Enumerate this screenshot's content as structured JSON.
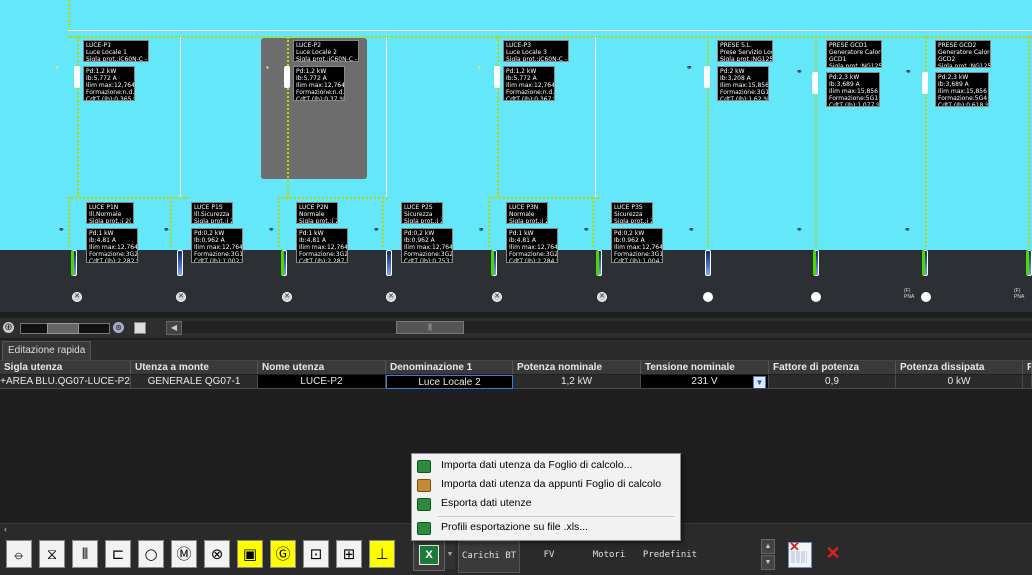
{
  "schematic": {
    "top_labels": [
      {
        "id": "p1",
        "lines": [
          "LUCE-P1",
          "Luce Locale 1",
          "Sigla prot.:iC60N-C - 1("
        ]
      },
      {
        "id": "p2",
        "lines": [
          "LUCE-P2",
          "Luce Locale 2",
          "Sigla prot.:iC60N-C - 1("
        ]
      },
      {
        "id": "p3",
        "lines": [
          "LUCE-P3",
          "Luce Locale 3",
          "Sigla prot.:iC60N-C - 1("
        ]
      },
      {
        "id": "ps",
        "lines": [
          "PRESE S.L.",
          "Prese Servizio Locali",
          "Sigla prot.:NG125L-"
        ]
      },
      {
        "id": "gcd1",
        "lines": [
          "PRESE GCD1",
          "Generatore Calore",
          "GCD1",
          "Sigla prot.:NG125L-"
        ]
      },
      {
        "id": "gcd2",
        "lines": [
          "PRESE GCD2",
          "Generatore Calore",
          "GCD2",
          "Sigla prot.:NG125N-"
        ]
      }
    ],
    "top_data": [
      {
        "id": "p1",
        "lines": [
          "Pd:1,2 kW",
          "Ib:5,772 A",
          "Ilim max:12,764 kA",
          "Formazione:n.d.",
          "CdtT (Ib):0,365 %"
        ]
      },
      {
        "id": "p2",
        "lines": [
          "Pd:1,2 kW",
          "Ib:5,772 A",
          "Ilim max:12,764 kA",
          "Formazione:n.d.",
          "CdtT (Ib):0,37 %"
        ]
      },
      {
        "id": "p3",
        "lines": [
          "Pd:1,2 kW",
          "Ib:5,772 A",
          "Ilim max:12,764 kA",
          "Formazione:n.d.",
          "CdtT (Ib):0,367 %"
        ]
      },
      {
        "id": "ps",
        "lines": [
          "Pd:2 kW",
          "Ib:3,208 A",
          "Ilim max:15,856 kA",
          "Formazione:3G1.5",
          "CdtT (Ib):1,62 %"
        ]
      },
      {
        "id": "gcd1",
        "lines": [
          "Pd:2,3 kW",
          "Ib:3,689 A",
          "Ilim max:15,856 kA",
          "Formazione:5G1.5",
          "CdtT (Ib):1,077 %"
        ]
      },
      {
        "id": "gcd2",
        "lines": [
          "Pd:2,3 kW",
          "Ib:3,689 A",
          "Ilim max:15,856 kA",
          "Formazione:5G4",
          "CdtT (Ib):0,618 %"
        ]
      }
    ],
    "bottom_labels": [
      {
        "id": "p1n",
        "lines": [
          "LUCE P1N",
          "Ill.Normale",
          "Sigla prot.:i 2("
        ]
      },
      {
        "id": "p1s",
        "lines": [
          "LUCE P1S",
          "Ill.Sicurezza",
          "Sigla prot.:i 2("
        ]
      },
      {
        "id": "p2n",
        "lines": [
          "LUCE P2N",
          "Normale",
          "Sigla prot.:i 2("
        ]
      },
      {
        "id": "p2s",
        "lines": [
          "LUCE P2S",
          "Sicurezza",
          "Sigla prot.:i 2("
        ]
      },
      {
        "id": "p3n",
        "lines": [
          "LUCE P3N",
          "Normale",
          "Sigla prot.:i 2("
        ]
      },
      {
        "id": "p3s",
        "lines": [
          "LUCE P3S",
          "Sicurezza",
          "Sigla prot.:i 2("
        ]
      }
    ],
    "bottom_data": [
      {
        "id": "p1n",
        "lines": [
          "Pd:1 kW",
          "Ib:4,81 A",
          "Ilim max:12,764 kA",
          "Formazione:3G2.5",
          "CdtT (Ib):2,282 %"
        ]
      },
      {
        "id": "p1s",
        "lines": [
          "Pd:0,2 kW",
          "Ib:0,962 A",
          "Ilim max:12,764 kA",
          "Formazione:3G1.5",
          "CdtT (Ib):1,002 %"
        ]
      },
      {
        "id": "p2n",
        "lines": [
          "Pd:1 kW",
          "Ib:4,81 A",
          "Ilim max:12,764 kA",
          "Formazione:3G2.5",
          "CdtT (Ib):2,287 %"
        ]
      },
      {
        "id": "p2s",
        "lines": [
          "Pd:0,2 kW",
          "Ib:0,962 A",
          "Ilim max:12,764 kA",
          "Formazione:3G2.5",
          "CdtT (Ib):0,753 %"
        ]
      },
      {
        "id": "p3n",
        "lines": [
          "Pd:1 kW",
          "Ib:4,81 A",
          "Ilim max:12,764 kA",
          "Formazione:3G2.5",
          "CdtT (Ib):2,284 %"
        ]
      },
      {
        "id": "p3s",
        "lines": [
          "Pd:0,2 kW",
          "Ib:0,962 A",
          "Ilim max:12,764 kA",
          "Formazione:3G1.5",
          "CdtT (Ib):1,004 %"
        ]
      }
    ],
    "pna_label": "(F)\nPNA"
  },
  "toolbar": {
    "scroll_thumb_glyph": "||"
  },
  "tabs": {
    "active_label": "Editazione rapida"
  },
  "grid": {
    "headers": [
      "Sigla utenza",
      "Utenza a monte",
      "Nome utenza",
      "Denominazione 1",
      "Potenza nominale",
      "Tensione nominale",
      "Fattore di potenza",
      "Potenza dissipata",
      "P"
    ],
    "row": {
      "sigla": "+AREA BLU.QG07-LUCE-P2",
      "utenza_monte": "GENERALE QG07-1",
      "nome": "LUCE-P2",
      "denominazione": "Luce Locale 2",
      "potenza": "1,2 kW",
      "tensione": "231 V",
      "fattore": "0,9",
      "dissipata": "0 kW"
    }
  },
  "menu": {
    "items": [
      {
        "label": "Importa dati utenza da Foglio di calcolo..."
      },
      {
        "label": "Importa dati utenza da appunti Foglio di calcolo"
      },
      {
        "label": "Esporta dati utenze"
      },
      {
        "label": "Profili esportazione su file .xls..."
      }
    ]
  },
  "bottombar": {
    "tabs": [
      "Carichi BT",
      "FV",
      "Motori",
      "Predefinit"
    ],
    "symbols": [
      "⦵",
      "⧖",
      "⦀",
      "⊏",
      "○",
      "Ⓜ",
      "⊗",
      "▣",
      "Ⓖ",
      "⊡",
      "⊞",
      "⊥"
    ]
  },
  "colors": {
    "cyan": "#64e7f8",
    "bus": "#b9d800",
    "accent": "#3b7ed8"
  }
}
